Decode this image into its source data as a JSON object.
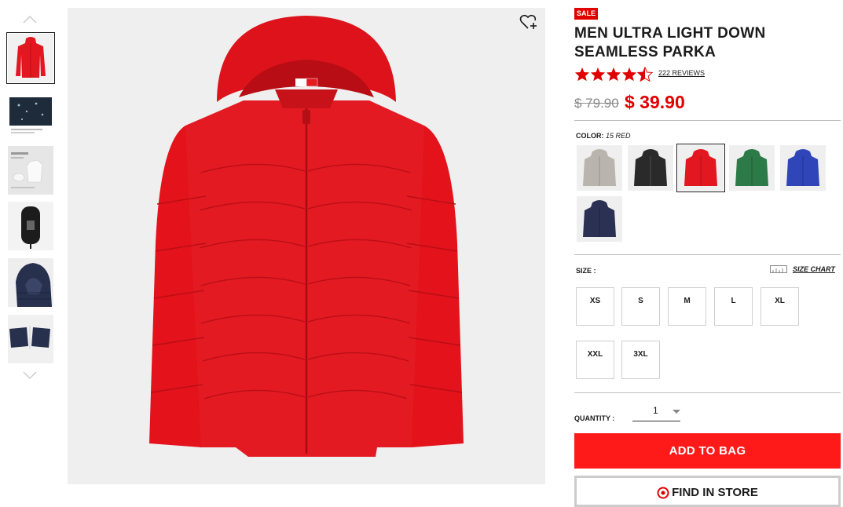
{
  "gallery": {
    "thumbnails": [
      {
        "name": "jacket-red-front",
        "selected": true
      },
      {
        "name": "fabric-water-detail",
        "selected": false
      },
      {
        "name": "packable-diagram",
        "selected": false
      },
      {
        "name": "storage-pouch",
        "selected": false
      },
      {
        "name": "navy-hood-detail",
        "selected": false
      },
      {
        "name": "navy-sleeve-detail",
        "selected": false
      }
    ],
    "main_image": "red-hooded-down-parka-front"
  },
  "product": {
    "badge": "SALE",
    "title": "MEN ULTRA LIGHT DOWN SEAMLESS PARKA",
    "rating": 4.5,
    "rating_max": 5,
    "reviews_label": "222 REVIEWS",
    "original_price": "$ 79.90",
    "sale_price": "$ 39.90"
  },
  "color": {
    "label": "COLOR:",
    "selected": "15 RED",
    "swatches": [
      {
        "name": "light-gray",
        "color": "#b9b4ae",
        "selected": false
      },
      {
        "name": "black",
        "color": "#2a2a2a",
        "selected": false
      },
      {
        "name": "red",
        "color": "#e3171f",
        "selected": true
      },
      {
        "name": "green",
        "color": "#2d7a49",
        "selected": false
      },
      {
        "name": "blue",
        "color": "#2f45b8",
        "selected": false
      },
      {
        "name": "navy",
        "color": "#2b3152",
        "selected": false
      }
    ]
  },
  "size": {
    "label": "SIZE :",
    "chart_label": "SIZE CHART",
    "options": [
      "XS",
      "S",
      "M",
      "L",
      "XL",
      "XXL",
      "3XL"
    ]
  },
  "quantity": {
    "label": "QUANTITY :",
    "value": "1"
  },
  "actions": {
    "add_to_bag": "ADD TO BAG",
    "find_in_store": "FIND IN STORE"
  },
  "colors": {
    "accent_red": "#ff1a1a",
    "sale_red": "#e00000"
  }
}
